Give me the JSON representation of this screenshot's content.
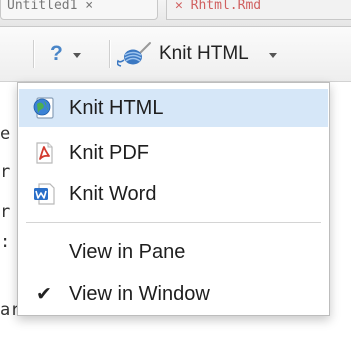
{
  "tabs": {
    "left_tab_text": "Untitled1 ×",
    "right_tab_text": "✕ Rhtml.Rmd"
  },
  "toolbar": {
    "help_label": "?",
    "knit_label": "Knit HTML"
  },
  "editor": {
    "edge_chars": [
      "e",
      "r",
      "r",
      ":"
    ],
    "bottom_line": "arkdown document. Markdo"
  },
  "menu": {
    "items": [
      {
        "label": "Knit HTML",
        "icon": "globe-html-icon"
      },
      {
        "label": "Knit PDF",
        "icon": "pdf-document-icon"
      },
      {
        "label": "Knit Word",
        "icon": "word-document-icon"
      }
    ],
    "view_items": [
      {
        "label": "View in Pane",
        "checked": false
      },
      {
        "label": "View in Window",
        "checked": true
      }
    ],
    "check_glyph": "✔"
  },
  "colors": {
    "menu_highlight": "#d6e7f8",
    "help_blue": "#4a86c8",
    "pdf_red": "#d33a2f",
    "word_blue": "#2a6fc9"
  }
}
